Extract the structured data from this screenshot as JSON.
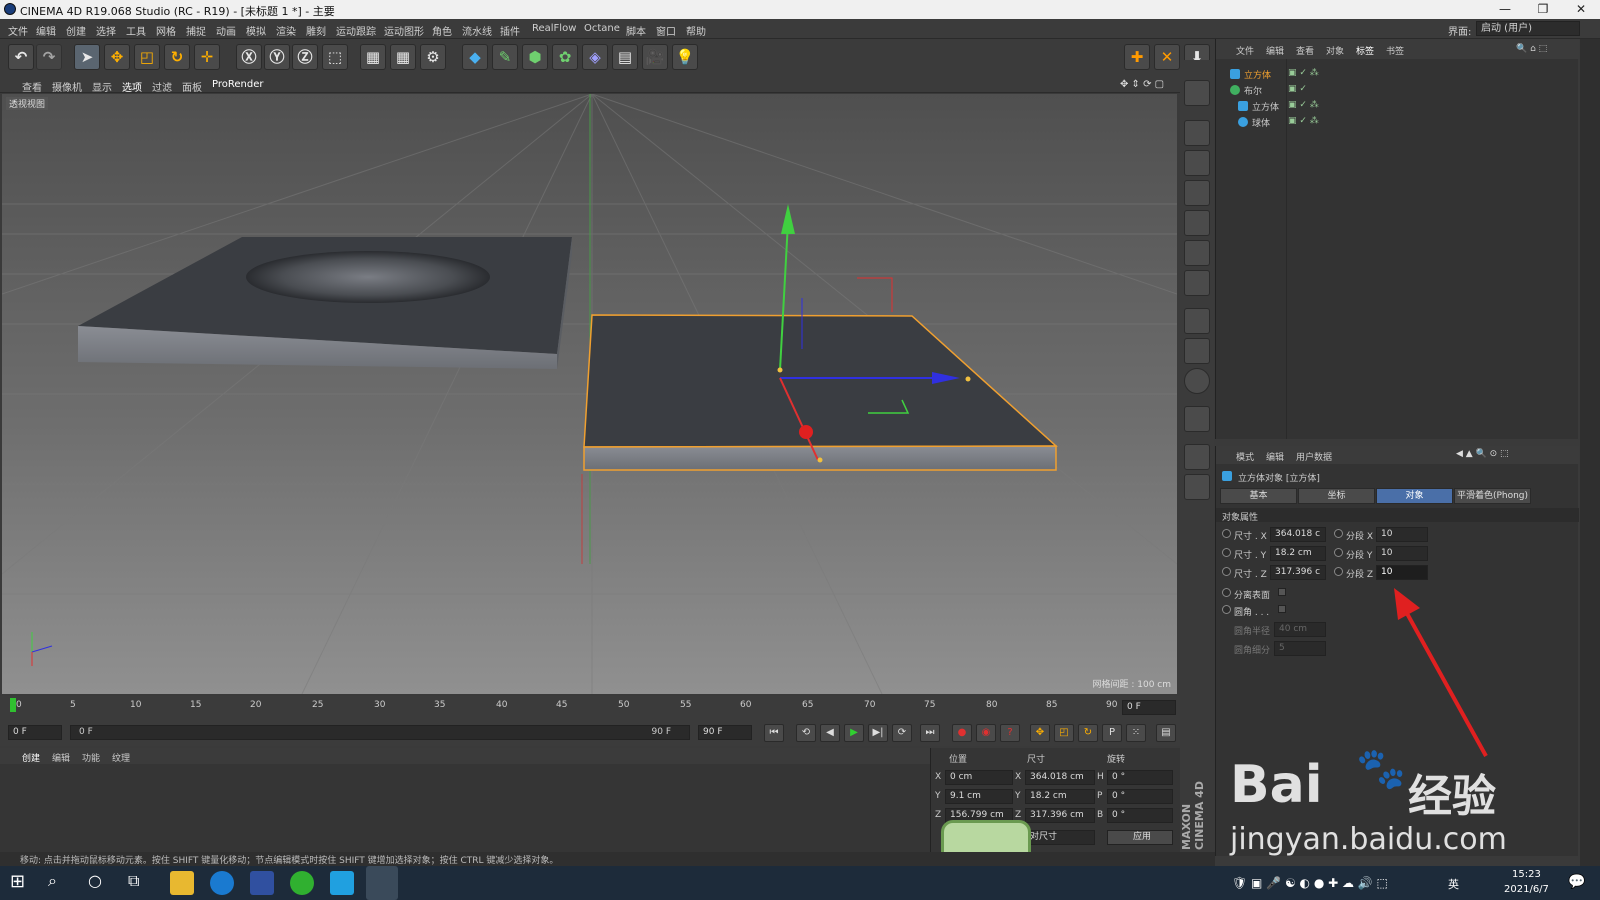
{
  "window": {
    "title": "CINEMA 4D R19.068 Studio (RC - R19) - [未标题 1 *] - 主要"
  },
  "menu": [
    "文件",
    "编辑",
    "创建",
    "选择",
    "工具",
    "网格",
    "捕捉",
    "动画",
    "模拟",
    "渲染",
    "雕刻",
    "运动跟踪",
    "运动图形",
    "角色",
    "流水线",
    "插件",
    "RealFlow",
    "Octane",
    "脚本",
    "窗口",
    "帮助"
  ],
  "layout": {
    "label": "界面:",
    "value": "启动 (用户)"
  },
  "viewport_menu": [
    "查看",
    "摄像机",
    "显示",
    "选项",
    "过滤",
    "面板",
    "ProRender"
  ],
  "viewport": {
    "label": "透视视图",
    "grid": "网格间距 : 100 cm"
  },
  "object_manager": {
    "menu": [
      "文件",
      "编辑",
      "查看",
      "对象",
      "标签",
      "书签"
    ],
    "objects": [
      {
        "name": "立方体",
        "level": 0,
        "selected": true
      },
      {
        "name": "布尔",
        "level": 0,
        "selected": false
      },
      {
        "name": "立方体",
        "level": 1,
        "selected": false
      },
      {
        "name": "球体",
        "level": 1,
        "selected": false
      }
    ]
  },
  "attributes": {
    "menu": [
      "模式",
      "编辑",
      "用户数据"
    ],
    "title": "立方体对象 [立方体]",
    "tabs": [
      "基本",
      "坐标",
      "对象",
      "平滑着色(Phong)"
    ],
    "active_tab": 2,
    "section": "对象属性",
    "size_x_label": "尺寸 . X",
    "size_x": "364.018 c",
    "size_y_label": "尺寸 . Y",
    "size_y": "18.2 cm",
    "size_z_label": "尺寸 . Z",
    "size_z": "317.396 c",
    "seg_x_label": "分段 X",
    "seg_x": "10",
    "seg_y_label": "分段 Y",
    "seg_y": "10",
    "seg_z_label": "分段 Z",
    "seg_z": "10",
    "separate_label": "分离表面",
    "fillet_label": "圆角 . . .",
    "fillet_radius_label": "圆角半径",
    "fillet_radius": "40 cm",
    "fillet_sub_label": "圆角细分",
    "fillet_sub": "5"
  },
  "timeline": {
    "ticks": [
      "0",
      "5",
      "10",
      "15",
      "20",
      "25",
      "30",
      "35",
      "40",
      "45",
      "50",
      "55",
      "60",
      "65",
      "70",
      "75",
      "80",
      "85",
      "90"
    ],
    "end_field": "0 F",
    "start": "0 F",
    "range_start": "0 F",
    "range_end": "90 F",
    "max": "90 F"
  },
  "material_menu": [
    "创建",
    "编辑",
    "功能",
    "纹理"
  ],
  "coords": {
    "headers": [
      "位置",
      "尺寸",
      "旋转"
    ],
    "rows": [
      {
        "a": "X",
        "pos": "0 cm",
        "b": "X",
        "size": "364.018 cm",
        "c": "H",
        "rot": "0 °"
      },
      {
        "a": "Y",
        "pos": "9.1 cm",
        "b": "Y",
        "size": "18.2 cm",
        "c": "P",
        "rot": "0 °"
      },
      {
        "a": "Z",
        "pos": "156.799 cm",
        "b": "Z",
        "size": "317.396 cm",
        "c": "B",
        "rot": "0 °"
      }
    ],
    "mode": "对尺寸",
    "apply": "应用"
  },
  "brand": "MAXON CINEMA 4D",
  "status": "移动: 点击并拖动鼠标移动元素。按住 SHIFT 键量化移动；节点编辑模式时按住 SHIFT 键增加选择对象；按住 CTRL 键减少选择对象。",
  "clock": {
    "time": "15:23",
    "date": "2021/6/7"
  },
  "ime": "英",
  "watermark": {
    "line1": "Bai",
    "line2": "经验",
    "line3": "jingyan.baidu.com"
  },
  "colors": {
    "accent": "#4a6fa8",
    "selection": "#f0a030",
    "arrow": "#e02020"
  }
}
